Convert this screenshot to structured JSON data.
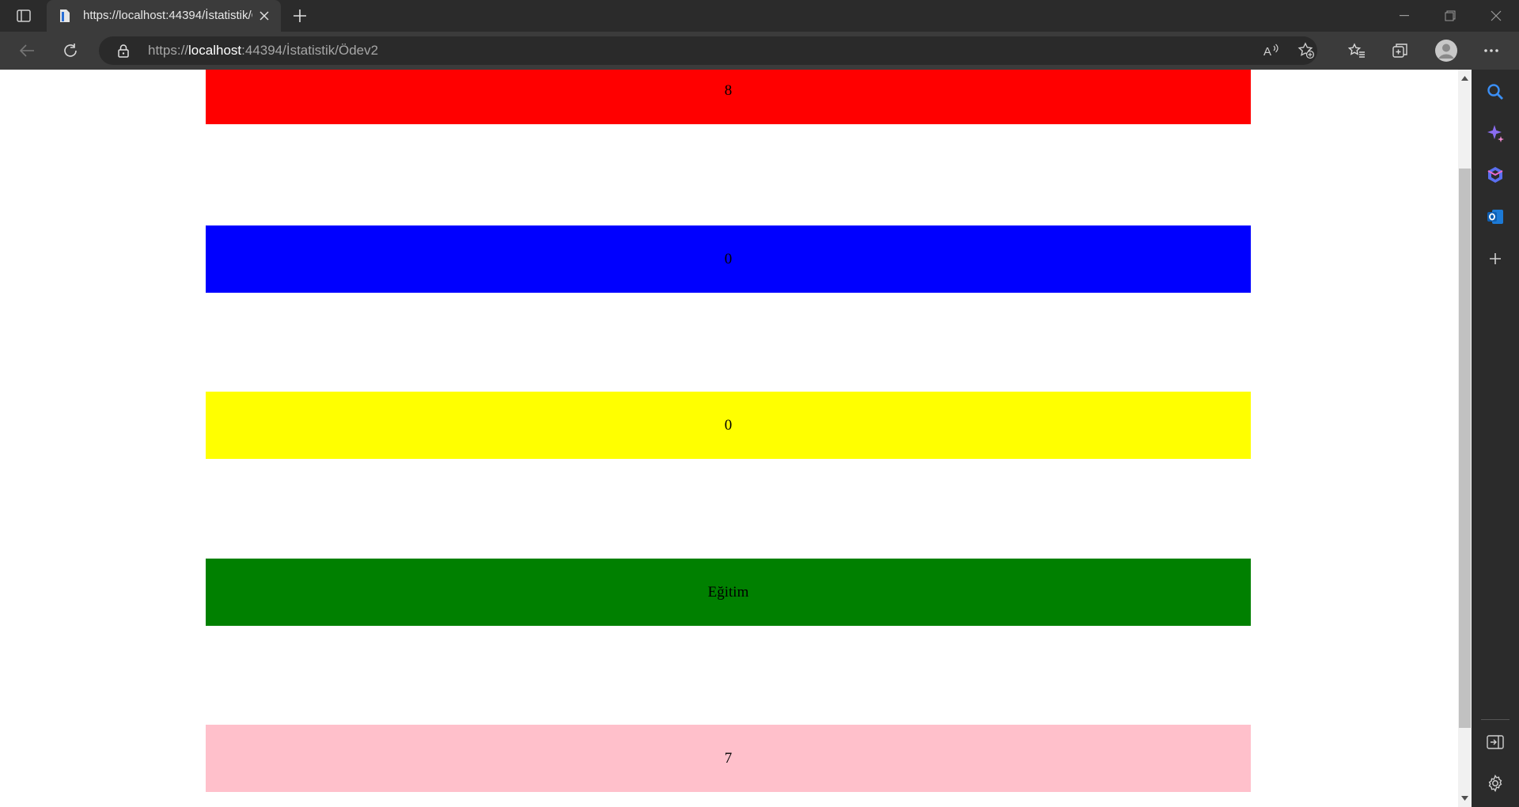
{
  "browser": {
    "tab": {
      "title": "https://localhost:44394/İstatistik/Ödev2"
    },
    "address": {
      "scheme": "https://",
      "host": "localhost",
      "rest": ":44394/İstatistik/Ödev2"
    },
    "icons": {
      "tab_actions": "tab-actions-icon",
      "favicon": "page-icon",
      "tab_close": "close-icon",
      "new_tab": "plus-icon",
      "minimize": "minimize-icon",
      "restore": "restore-icon",
      "close_window": "close-icon",
      "back": "back-arrow-icon",
      "refresh": "refresh-icon",
      "lock": "lock-icon",
      "read_aloud": "read-aloud-icon",
      "add_favorite": "add-favorite-icon",
      "favorites": "favorites-icon",
      "collections": "collections-icon",
      "profile": "profile-avatar-icon",
      "more": "more-icon"
    },
    "sidebar": [
      "search-icon",
      "copilot-icon",
      "office-icon",
      "outlook-icon",
      "plus-icon",
      "split-screen-icon",
      "settings-icon"
    ]
  },
  "page": {
    "bars": [
      {
        "label": "8",
        "color": "#ff0000"
      },
      {
        "label": "0",
        "color": "#0000ff"
      },
      {
        "label": "0",
        "color": "#ffff00"
      },
      {
        "label": "Eğitim",
        "color": "#008000"
      },
      {
        "label": "7",
        "color": "#ffc0cb"
      }
    ]
  }
}
